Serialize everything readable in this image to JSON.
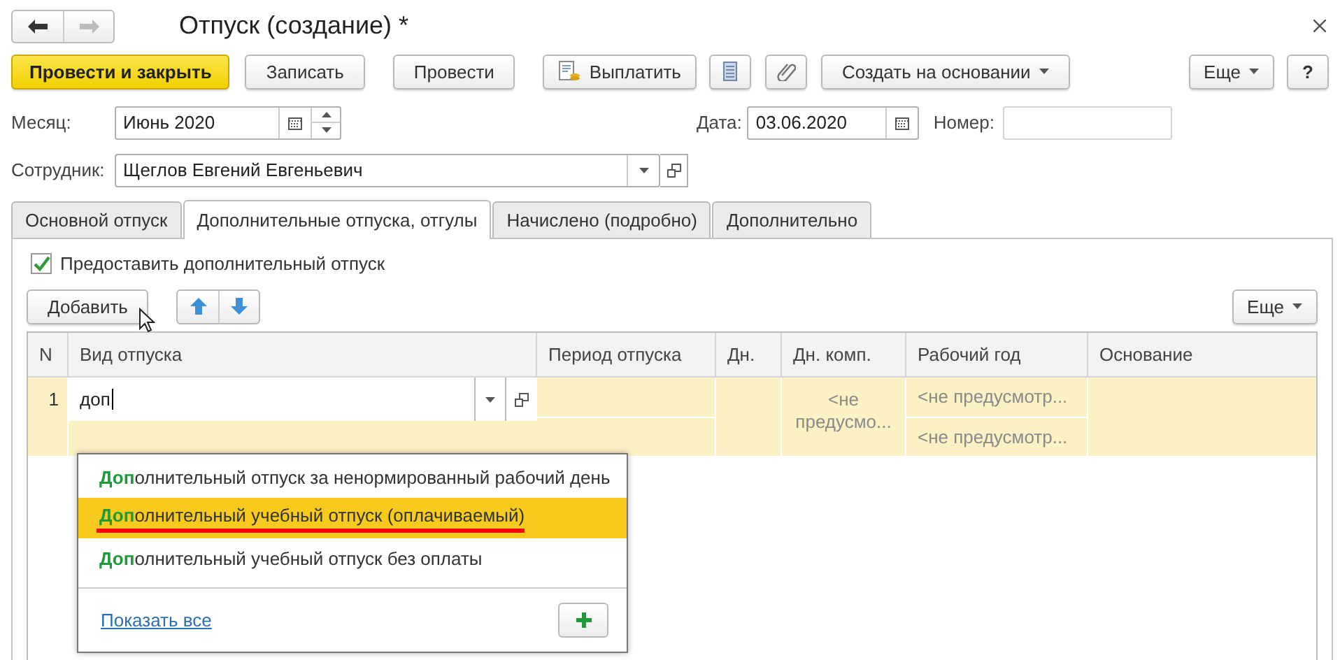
{
  "window": {
    "title": "Отпуск (создание) *",
    "back_enabled": true,
    "forward_enabled": false
  },
  "toolbar": {
    "buttons": [
      {
        "kind": "primary",
        "label": "Провести и закрыть"
      },
      {
        "kind": "text",
        "label": "Записать"
      },
      {
        "kind": "text",
        "label": "Провести"
      },
      {
        "kind": "pay",
        "label": "Выплатить"
      },
      {
        "kind": "report"
      },
      {
        "kind": "attach"
      },
      {
        "kind": "dropdown",
        "label": "Создать на основании"
      }
    ],
    "more": "Еще",
    "help": "?"
  },
  "header": {
    "month": {
      "label": "Месяц:",
      "value": "Июнь 2020"
    },
    "date": {
      "label": "Дата:",
      "value": "03.06.2020"
    },
    "number": {
      "label": "Номер:"
    },
    "employee": {
      "label": "Сотрудник:",
      "value": "Щеглов Евгений Евгеньевич"
    }
  },
  "tabs": [
    {
      "label": "Основной отпуск",
      "selected": false
    },
    {
      "label": "Дополнительные отпуска, отгулы",
      "selected": true
    },
    {
      "label": "Начислено (подробно)",
      "selected": false
    },
    {
      "label": "Дополнительно",
      "selected": false
    }
  ],
  "grant_checkbox": {
    "label": "Предоставить дополнительный отпуск",
    "checked": true
  },
  "table_toolbar": {
    "add": "Добавить",
    "more": "Еще"
  },
  "table": {
    "columns": [
      "N",
      "Вид отпуска",
      "Период отпуска",
      "Дн.",
      "Дн. комп.",
      "Рабочий год",
      "Основание"
    ],
    "rows": [
      {
        "n": "1",
        "leave_type_input": "доп",
        "comp_days": "<не предусмо...",
        "work_years": [
          "<не предусмотр...",
          "<не предусмотр..."
        ]
      }
    ]
  },
  "autocomplete": {
    "items": [
      {
        "text": "**Доп**олнительный отпуск за ненормированный рабочий день",
        "selected": false,
        "underlined": false
      },
      {
        "text": "**Доп**олнительный учебный отпуск (оплачиваемый)",
        "selected": true,
        "underlined": true
      },
      {
        "text": "**Доп**олнительный учебный отпуск без оплаты",
        "selected": false,
        "underlined": false
      }
    ],
    "show_all": "Показать все"
  }
}
